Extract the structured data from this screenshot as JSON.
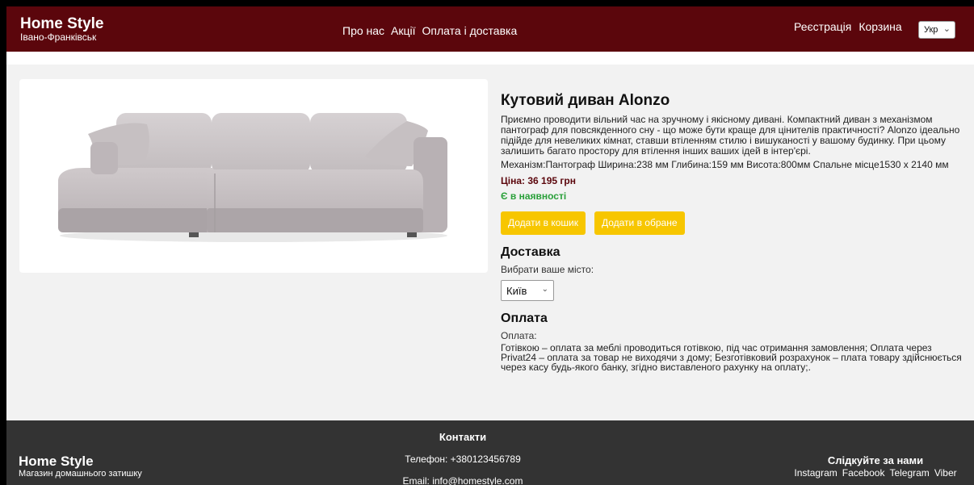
{
  "header": {
    "brand_title": "Home Style",
    "brand_city": "Івано-Франківськ",
    "nav": [
      "Про нас",
      "Акції",
      "Оплата і доставка"
    ],
    "register": "Реєстрація",
    "cart": "Корзина",
    "language": "Укр"
  },
  "product": {
    "title": "Кутовий диван Alonzo",
    "description": "Приємно проводити вільний час на зручному і якісному дивані. Компактний диван з механізмом пантограф для повсякденного сну - що може бути краще для цінителів практичності? Alonzo ідеально підійде для невеликих кімнат, ставши втіленням стилю і вишуканості у вашому будинку. При цьому залишить багато простору для втілення інших ваших ідей в інтер'єрі.",
    "specs": "Механізм:Пантограф Ширина:238 мм Глибина:159 мм Висота:800мм Спальне місце1530 х 2140 мм",
    "price": "Ціна: 36 195 грн",
    "stock": "Є в наявності",
    "add_to_cart": "Додати в кошик",
    "add_to_favorites": "Додати в обране"
  },
  "delivery": {
    "title": "Доставка",
    "label": "Вибрати ваше місто:",
    "city": "Київ"
  },
  "payment": {
    "title": "Оплата",
    "label": "Оплата:",
    "text": "Готівкою – оплата за меблі проводиться готівкою, під час отримання замовлення; Оплата через Privat24 – оплата за товар не виходячи з дому; Безготівковий розрахунок – плата товару здійснюється через касу будь-якого банку, згідно виставленого рахунку на оплату;."
  },
  "footer": {
    "brand_title": "Home Style",
    "brand_subtitle": "Магазин домашнього затишку",
    "contacts_title": "Контакти",
    "phone": "Телефон: +380123456789",
    "email": "Email: info@homestyle.com",
    "follow_title": "Слідкуйте за нами",
    "social": [
      "Instagram",
      "Facebook",
      "Telegram",
      "Viber"
    ]
  },
  "colors": {
    "header_bg": "#5b060c",
    "button": "#f7c600",
    "in_stock": "#2aa03a",
    "footer_bg": "#333333"
  }
}
